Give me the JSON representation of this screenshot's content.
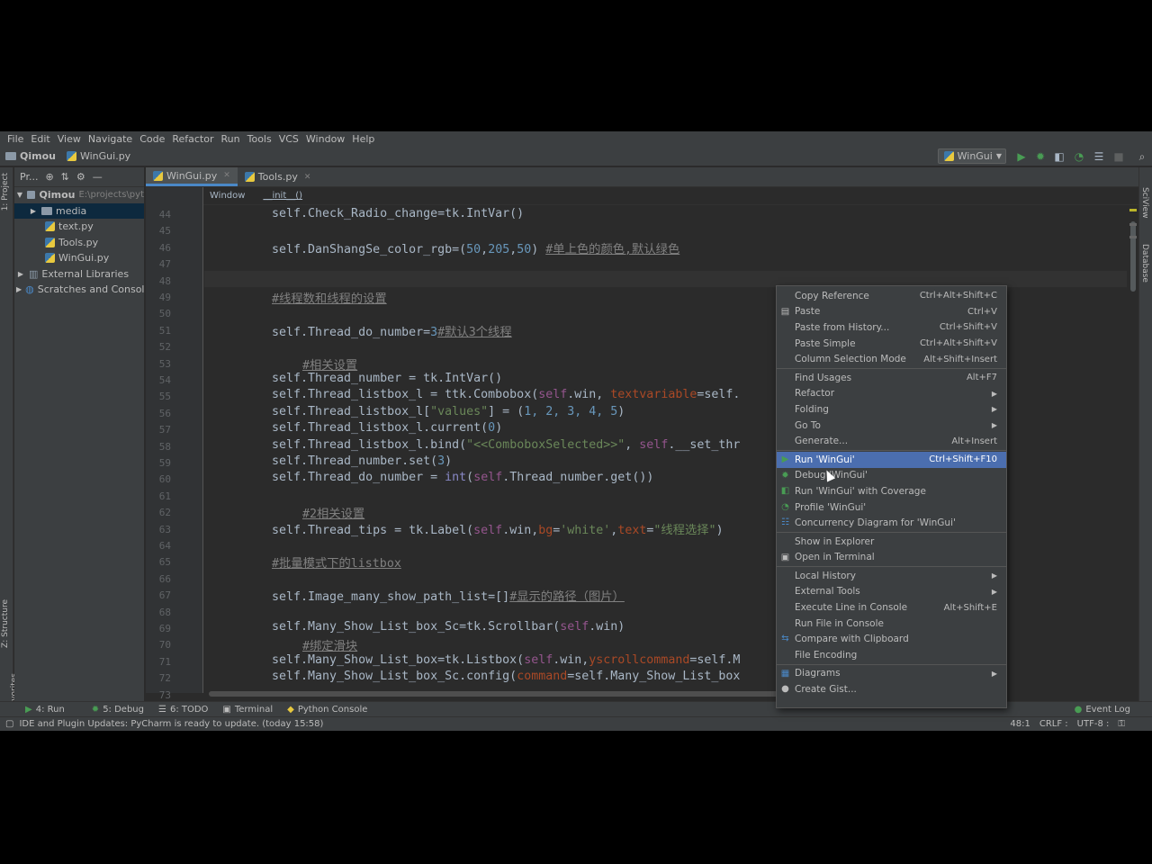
{
  "menu": [
    "File",
    "Edit",
    "View",
    "Navigate",
    "Code",
    "Refactor",
    "Run",
    "Tools",
    "VCS",
    "Window",
    "Help"
  ],
  "navbar": {
    "project": "Qimou",
    "file": "WinGui.py",
    "run_config": "WinGui"
  },
  "left_stripe": {
    "project": "1: Project",
    "structure": "Z: Structure",
    "favorites": "2: Favorites"
  },
  "right_stripe": {
    "sciview": "SciView",
    "database": "Database"
  },
  "project_panel": {
    "title": "Pr...",
    "root": "Qimou",
    "root_path": "E:\\projects\\pyt",
    "items": [
      "media",
      "text.py",
      "Tools.py",
      "WinGui.py",
      "External Libraries",
      "Scratches and Consoles"
    ]
  },
  "tabs": [
    {
      "label": "WinGui.py",
      "active": true
    },
    {
      "label": "Tools.py",
      "active": false
    }
  ],
  "editor_breadcrumb": [
    "Window",
    "__init__()"
  ],
  "line_numbers": [
    "44",
    "45",
    "46",
    "47",
    "48",
    "49",
    "50",
    "51",
    "52",
    "53",
    "54",
    "55",
    "56",
    "57",
    "58",
    "59",
    "60",
    "61",
    "62",
    "63",
    "64",
    "65",
    "66",
    "67",
    "68",
    "69",
    "70",
    "71",
    "72",
    "73"
  ],
  "code": {
    "l44": "self.Check_Radio_change=tk.IntVar()",
    "l46a": "self.DanShangSe_color_rgb=(",
    "l46n1": "50",
    "l46n2": "205",
    "l46n3": "50",
    "l46c": "#单上色的颜色,默认绿色",
    "l49": "#线程数和线程的设置",
    "l51a": "self.Thread_do_number=",
    "l51n": "3",
    "l51c": "#默认3个线程",
    "l53": "#相关设置",
    "l54": "self.Thread_number = tk.IntVar()",
    "l55a": "self.Thread_listbox_l = ttk.Combobox(",
    "l55b": "self",
    "l55c": ".win, ",
    "l55d": "textvariable",
    "l55e": "=self.",
    "l56a": "self.Thread_listbox_l[",
    "l56s": "\"values\"",
    "l56b": "] = (",
    "l56n": "1, 2, 3, 4, 5",
    "l56e": ")",
    "l57a": "self.Thread_listbox_l.current(",
    "l57n": "0",
    "l57e": ")",
    "l58a": "self.Thread_listbox_l.bind(",
    "l58s": "\"<<ComboboxSelected>>\"",
    "l58b": ", ",
    "l58c": "self",
    "l58d": ".__set_thr",
    "l59a": "self.Thread_number.set(",
    "l59n": "3",
    "l59e": ")",
    "l60a": "self.Thread_do_number = ",
    "l60b": "int",
    "l60c": "(",
    "l60d": "self",
    "l60e": ".Thread_number.get())",
    "l62": "#2相关设置",
    "l63a": "self.Thread_tips = tk.Label(",
    "l63b": "self",
    "l63c": ".win,",
    "l63d": "bg",
    "l63e": "=",
    "l63f": "'white'",
    "l63g": ",",
    "l63h": "text",
    "l63i": "=",
    "l63j": "\"线程选择\"",
    "l63k": ")",
    "l65": "#批量模式下的listbox",
    "l67a": "self.Image_many_show_path_list=[]",
    "l67c": "#显示的路径（图片）",
    "l69a": "self.Many_Show_List_box_Sc=tk.Scrollbar(",
    "l69b": "self",
    "l69c": ".win)",
    "l70": "#绑定滑块",
    "l71a": "self.Many_Show_List_box=tk.Listbox(",
    "l71b": "self",
    "l71c": ".win,",
    "l71d": "yscrollcommand",
    "l71e": "=self.M",
    "l72a": "self.Many_Show_List_box_Sc.config(",
    "l72b": "command",
    "l72c": "=self.Many_Show_List_box"
  },
  "context_menu": [
    {
      "label": "Copy Reference",
      "shortcut": "Ctrl+Alt+Shift+C"
    },
    {
      "label": "Paste",
      "shortcut": "Ctrl+V",
      "icon": "paste-icon"
    },
    {
      "label": "Paste from History...",
      "shortcut": "Ctrl+Shift+V"
    },
    {
      "label": "Paste Simple",
      "shortcut": "Ctrl+Alt+Shift+V"
    },
    {
      "label": "Column Selection Mode",
      "shortcut": "Alt+Shift+Insert"
    },
    {
      "label": "Find Usages",
      "shortcut": "Alt+F7"
    },
    {
      "label": "Refactor",
      "submenu": true
    },
    {
      "label": "Folding",
      "submenu": true
    },
    {
      "label": "Go To",
      "submenu": true
    },
    {
      "label": "Generate...",
      "shortcut": "Alt+Insert"
    },
    {
      "label": "Run 'WinGui'",
      "shortcut": "Ctrl+Shift+F10",
      "icon": "run-icon",
      "highlight": true
    },
    {
      "label": "Debug 'WinGui'",
      "icon": "debug-icon"
    },
    {
      "label": "Run 'WinGui' with Coverage",
      "icon": "coverage-icon"
    },
    {
      "label": "Profile 'WinGui'",
      "icon": "profile-icon"
    },
    {
      "label": "Concurrency Diagram for 'WinGui'",
      "icon": "concurrency-icon"
    },
    {
      "label": "Show in Explorer"
    },
    {
      "label": "Open in Terminal",
      "icon": "terminal-icon"
    },
    {
      "label": "Local History",
      "submenu": true
    },
    {
      "label": "External Tools",
      "submenu": true
    },
    {
      "label": "Execute Line in Console",
      "shortcut": "Alt+Shift+E"
    },
    {
      "label": "Run File in Console"
    },
    {
      "label": "Compare with Clipboard",
      "icon": "compare-icon"
    },
    {
      "label": "File Encoding"
    },
    {
      "label": "Diagrams",
      "submenu": true,
      "icon": "diagrams-icon"
    },
    {
      "label": "Create Gist...",
      "icon": "github-icon"
    }
  ],
  "bottom_tools": [
    "4: Run",
    "5: Debug",
    "6: TODO",
    "Terminal",
    "Python Console"
  ],
  "event_log": "Event Log",
  "status": {
    "message": "IDE and Plugin Updates: PyCharm is ready to update. (today 15:58)",
    "position": "48:1",
    "line_sep": "CRLF :",
    "encoding": "UTF-8 :"
  },
  "colors": {
    "accent": "#4b6eaf",
    "background": "#2b2b2b",
    "panel": "#3c3f41"
  }
}
